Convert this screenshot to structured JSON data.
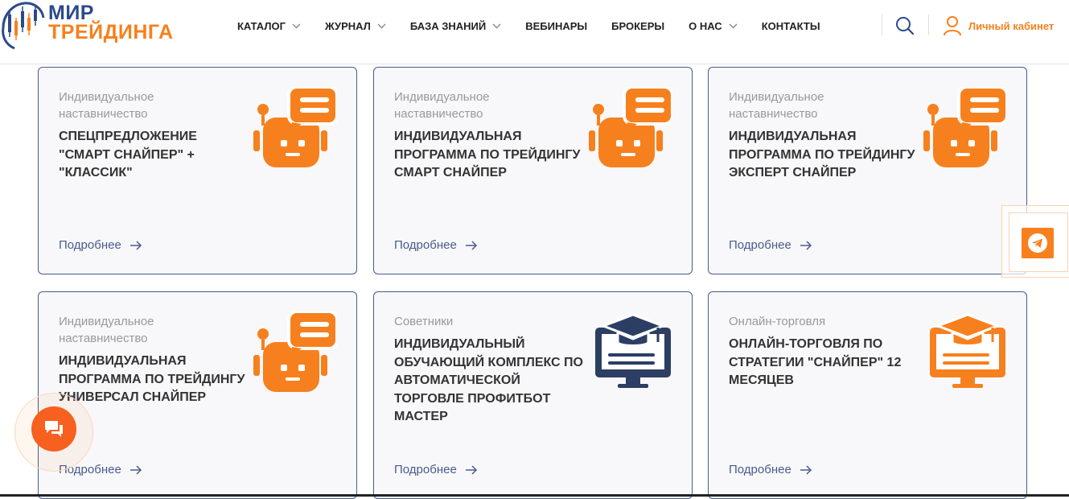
{
  "logo": {
    "line1": "МИР",
    "line2": "ТРЕЙДИНГА"
  },
  "nav": [
    {
      "label": "КАТАЛОГ",
      "has_dropdown": true
    },
    {
      "label": "ЖУРНАЛ",
      "has_dropdown": true
    },
    {
      "label": "БАЗА ЗНАНИЙ",
      "has_dropdown": true
    },
    {
      "label": "ВЕБИНАРЫ",
      "has_dropdown": false
    },
    {
      "label": "БРОКЕРЫ",
      "has_dropdown": false
    },
    {
      "label": "О НАС",
      "has_dropdown": true
    },
    {
      "label": "КОНТАКТЫ",
      "has_dropdown": false
    }
  ],
  "header": {
    "search_icon": "search-icon",
    "cabinet_label": "Личный кабинет",
    "cabinet_icon": "user-icon"
  },
  "cards": [
    {
      "category": "Индивидуальное наставничество",
      "title": "СПЕЦПРЕДЛОЖЕНИЕ \"СМАРТ СНАЙПЕР\" + \"КЛАССИК\"",
      "link": "Подробнее",
      "icon": "robot-chat-icon"
    },
    {
      "category": "Индивидуальное наставничество",
      "title": "ИНДИВИДУАЛЬНАЯ ПРОГРАММА ПО ТРЕЙДИНГУ СМАРТ СНАЙПЕР",
      "link": "Подробнее",
      "icon": "robot-chat-icon"
    },
    {
      "category": "Индивидуальное наставничество",
      "title": "ИНДИВИДУАЛЬНАЯ ПРОГРАММА ПО ТРЕЙДИНГУ ЭКСПЕРТ СНАЙПЕР",
      "link": "Подробнее",
      "icon": "robot-chat-icon"
    },
    {
      "category": "Индивидуальное наставничество",
      "title": "ИНДИВИДУАЛЬНАЯ ПРОГРАММА ПО ТРЕЙДИНГУ УНИВЕРСАЛ СНАЙПЕР",
      "link": "Подробнее",
      "icon": "robot-chat-icon"
    },
    {
      "category": "Советники",
      "title": "ИНДИВИДУАЛЬНЫЙ ОБУЧАЮЩИЙ КОМПЛЕКС ПО АВТОМАТИЧЕСКОЙ ТОРГОВЛЕ ПРОФИТБОТ МАСТЕР",
      "link": "Подробнее",
      "icon": "graduation-monitor-icon"
    },
    {
      "category": "Онлайн-торговля",
      "title": "ОНЛАЙН-ТОРГОВЛЯ ПО СТРАТЕГИИ \"СНАЙПЕР\" 12 МЕСЯЦЕВ",
      "link": "Подробнее",
      "icon": "graduation-monitor-icon"
    }
  ],
  "widgets": {
    "telegram_icon": "telegram-icon",
    "chat_icon": "chat-icon"
  },
  "colors": {
    "brand_blue": "#2c4a8a",
    "brand_orange": "#f7801e",
    "card_border": "#4a5a8c",
    "dark_navy": "#2c3e63"
  }
}
